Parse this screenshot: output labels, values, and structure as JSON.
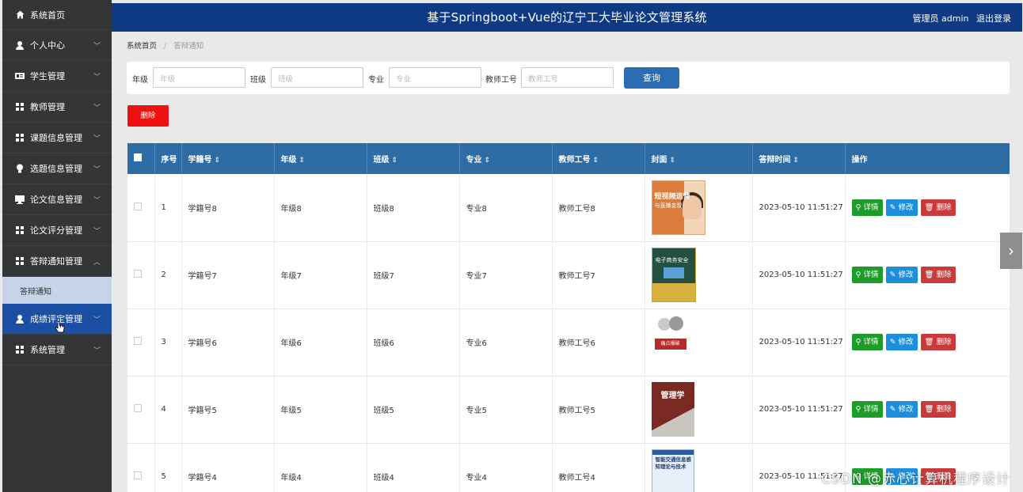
{
  "header": {
    "title": "基于Springboot+Vue的辽宁工大毕业论文管理系统",
    "user_label": "管理员 admin",
    "logout": "退出登录"
  },
  "sidebar": {
    "items": [
      {
        "label": "系统首页",
        "icon": "home-icon"
      },
      {
        "label": "个人中心",
        "icon": "user-icon"
      },
      {
        "label": "学生管理",
        "icon": "id-card-icon"
      },
      {
        "label": "教师管理",
        "icon": "grid-icon"
      },
      {
        "label": "课题信息管理",
        "icon": "grid-icon"
      },
      {
        "label": "选题信息管理",
        "icon": "bulb-icon"
      },
      {
        "label": "论文信息管理",
        "icon": "monitor-icon"
      },
      {
        "label": "论文评分管理",
        "icon": "grid-icon"
      },
      {
        "label": "答辩通知管理",
        "icon": "grid-icon"
      },
      {
        "label": "成绩评定管理",
        "icon": "user-icon"
      },
      {
        "label": "系统管理",
        "icon": "grid-icon"
      }
    ],
    "sub_item": "答辩通知"
  },
  "breadcrumb": {
    "home": "系统首页",
    "sep": "/",
    "current": "答辩通知"
  },
  "search": {
    "grade_label": "年级",
    "grade_placeholder": "年级",
    "class_label": "班级",
    "class_placeholder": "班级",
    "major_label": "专业",
    "major_placeholder": "专业",
    "teacher_label": "教师工号",
    "teacher_placeholder": "教师工号",
    "query_button": "查询"
  },
  "delete_button": "删除",
  "table": {
    "headers": {
      "index": "序号",
      "student_no": "学籍号",
      "grade": "年级",
      "class": "班级",
      "major": "专业",
      "teacher_no": "教师工号",
      "cover": "封面",
      "defense_time": "答辩时间",
      "ops": "操作"
    },
    "sort_glyph": "⇕",
    "op_labels": {
      "detail": "详情",
      "edit": "修改",
      "delete": "删除"
    },
    "rows": [
      {
        "index": "1",
        "student_no": "学籍号8",
        "grade": "年级8",
        "class": "班级8",
        "major": "专业8",
        "teacher_no": "教师工号8",
        "time": "2023-05-10 11:51:27",
        "cover_title": "短视频运营",
        "cover_sub": "与直播变现"
      },
      {
        "index": "2",
        "student_no": "学籍号7",
        "grade": "年级7",
        "class": "班级7",
        "major": "专业7",
        "teacher_no": "教师工号7",
        "time": "2023-05-10 11:51:27",
        "cover_title": "电子商务安全"
      },
      {
        "index": "3",
        "student_no": "学籍号6",
        "grade": "年级6",
        "class": "班级6",
        "major": "专业6",
        "teacher_no": "教师工号6",
        "time": "2023-05-10 11:51:27",
        "cover_title": "痛点爆破"
      },
      {
        "index": "4",
        "student_no": "学籍号5",
        "grade": "年级5",
        "class": "班级5",
        "major": "专业5",
        "teacher_no": "教师工号5",
        "time": "2023-05-10 11:51:27",
        "cover_title": "管理学"
      },
      {
        "index": "5",
        "student_no": "学籍号4",
        "grade": "年级4",
        "class": "班级4",
        "major": "专业4",
        "teacher_no": "教师工号4",
        "time": "2023-05-10 11:51:27",
        "cover_title": "智能交通信息感知理论与技术"
      }
    ]
  },
  "watermark": "CSDN @赤心计算机程序设计"
}
